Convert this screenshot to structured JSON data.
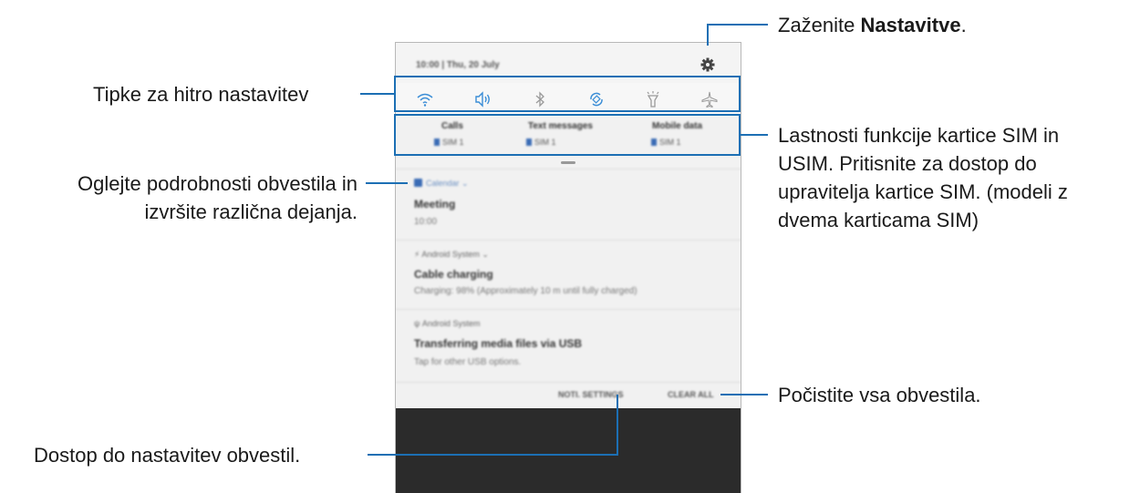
{
  "callouts": {
    "settings_prefix": "Zaženite ",
    "settings_bold": "Nastavitve",
    "settings_suffix": ".",
    "quick_settings": "Tipke za hitro nastavitev",
    "sim_line1": "Lastnosti funkcije kartice SIM in",
    "sim_line2": "USIM. Pritisnite za dostop do",
    "sim_line3": "upravitelja kartice SIM. (modeli z",
    "sim_line4": "dvema karticama SIM)",
    "details_line1": "Oglejte podrobnosti obvestila in",
    "details_line2": "izvršite različna dejanja.",
    "clear_all": "Počistite vsa obvestila.",
    "notif_settings": "Dostop do nastavitev obvestil."
  },
  "phone": {
    "status_bar": {
      "time_date": "10:00 | Thu, 20 July"
    },
    "quick_settings": [
      "wifi-icon",
      "sound-icon",
      "bluetooth-icon",
      "auto-rotate-icon",
      "flashlight-icon",
      "airplane-icon"
    ],
    "sim": [
      {
        "label": "Calls",
        "sim": "SIM 1"
      },
      {
        "label": "Text messages",
        "sim": "SIM 1"
      },
      {
        "label": "Mobile data",
        "sim": "SIM 1"
      }
    ],
    "notifications": [
      {
        "app": "Calendar ⌄",
        "title": "Meeting",
        "text": "10:00"
      },
      {
        "app": "⚡ Android System ⌄",
        "title": "Cable charging",
        "text": "Charging: 98% (Approximately 10 m until fully charged)"
      },
      {
        "app": "ψ Android System",
        "title": "Transferring media files via USB",
        "text": "Tap for other USB options."
      }
    ],
    "actions": {
      "notif_settings": "NOTI. SETTINGS",
      "clear_all": "CLEAR ALL"
    }
  },
  "colors": {
    "accent": "#1c6fb4",
    "phone_bg": "#f2f2f2",
    "dark_bottom": "#2b2b2b"
  }
}
